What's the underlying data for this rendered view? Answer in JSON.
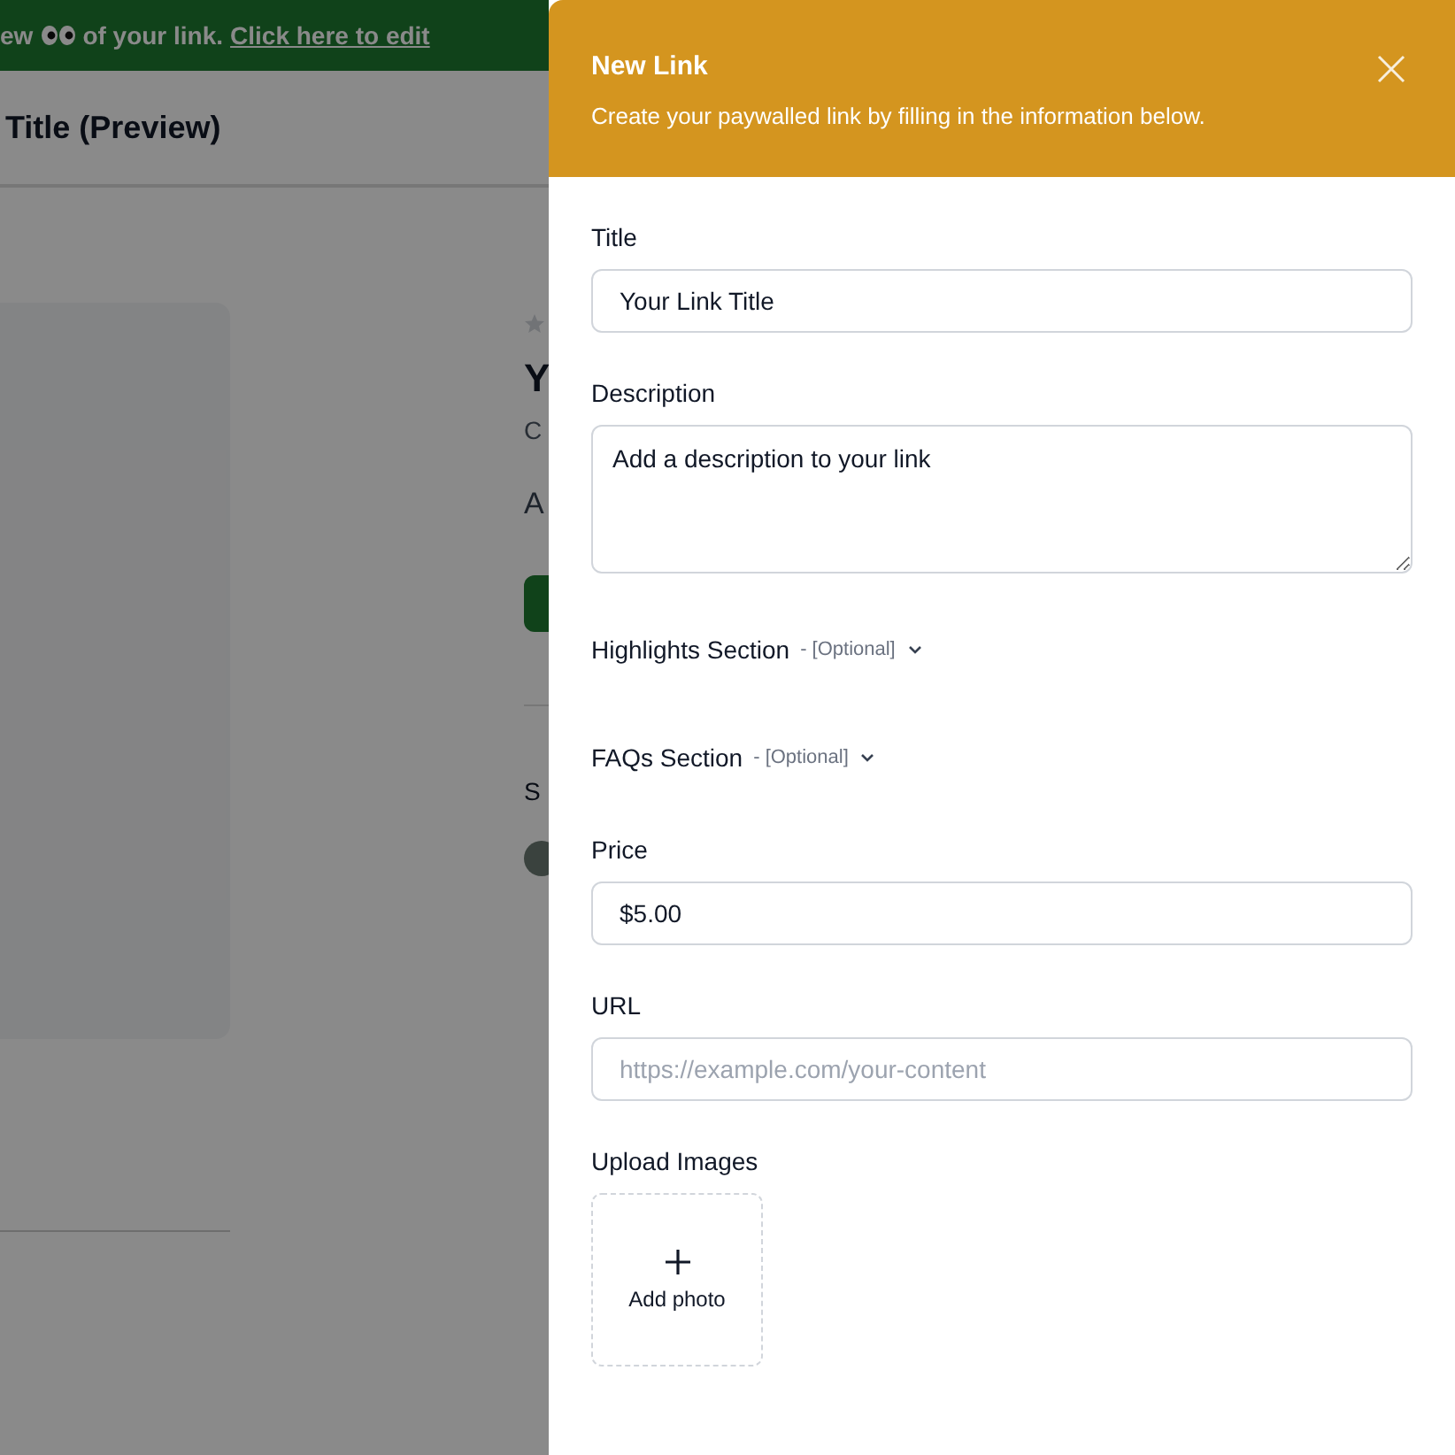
{
  "background_page": {
    "banner": {
      "text_before": "ew",
      "text_after": "of your link.",
      "link": "Click here to edit"
    },
    "header_title": "Title (Preview)",
    "preview": {
      "title": "Y",
      "subtitle": "C",
      "description": "A",
      "share_label": "S"
    }
  },
  "dialog": {
    "title": "New Link",
    "subtitle": "Create your paywalled link by filling in the information below.",
    "fields": [
      {
        "kind": "input",
        "label": "Title",
        "value": "Your Link Title"
      },
      {
        "kind": "textarea",
        "label": "Description",
        "value": "Add a description to your link"
      },
      {
        "kind": "section",
        "label": "Highlights Section",
        "note": "- [Optional]",
        "expanded": false
      },
      {
        "kind": "section",
        "label": "FAQs Section",
        "note": "- [Optional]",
        "expanded": false
      },
      {
        "kind": "input",
        "label": "Price",
        "value": "$5.00"
      },
      {
        "kind": "input",
        "label": "URL",
        "placeholder": "https://example.com/your-content"
      },
      {
        "kind": "upload",
        "label": "Upload Images",
        "button": "Add photo"
      }
    ]
  }
}
